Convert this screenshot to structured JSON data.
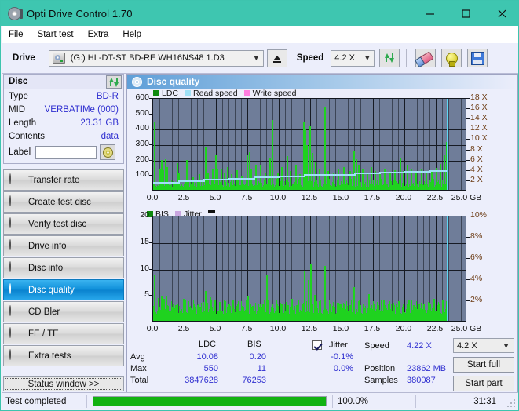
{
  "window": {
    "title": "Opti Drive Control 1.70",
    "icon": "disc-drive-icon",
    "minimize": "—",
    "maximize": "☐",
    "close": "✕"
  },
  "menu": [
    {
      "label": "File"
    },
    {
      "label": "Start test"
    },
    {
      "label": "Extra"
    },
    {
      "label": "Help"
    }
  ],
  "toolbar": {
    "drive_label": "Drive",
    "drive_value": "(G:)  HL-DT-ST BD-RE  WH16NS48 1.D3",
    "eject_title": "eject-icon",
    "speed_label": "Speed",
    "speed_value": "4.2 X",
    "refresh_icon": "refresh-arrows-icon",
    "erase_icon": "eraser-icon",
    "bulb_icon": "bulb-icon",
    "save_icon": "floppy-save-icon"
  },
  "disc": {
    "header": "Disc",
    "refresh_icon": "refresh-arrows-icon",
    "rows": [
      {
        "key": "Type",
        "value": "BD-R"
      },
      {
        "key": "MID",
        "value": "VERBATIMe (000)"
      },
      {
        "key": "Length",
        "value": "23.31 GB"
      },
      {
        "key": "Contents",
        "value": "data"
      }
    ],
    "label_key": "Label",
    "label_value": "",
    "label_placeholder": ""
  },
  "nav": {
    "items": [
      {
        "label": "Transfer rate",
        "selected": false
      },
      {
        "label": "Create test disc",
        "selected": false
      },
      {
        "label": "Verify test disc",
        "selected": false
      },
      {
        "label": "Drive info",
        "selected": false
      },
      {
        "label": "Disc info",
        "selected": false
      },
      {
        "label": "Disc quality",
        "selected": true
      },
      {
        "label": "CD Bler",
        "selected": false
      },
      {
        "label": "FE / TE",
        "selected": false
      },
      {
        "label": "Extra tests",
        "selected": false
      }
    ],
    "status_window": "Status window >>"
  },
  "content": {
    "title": "Disc quality",
    "icon": "disc-quality-icon"
  },
  "stats": {
    "col_ldc": "LDC",
    "col_bis": "BIS",
    "row_avg": "Avg",
    "row_max": "Max",
    "row_total": "Total",
    "ldc_avg": "10.08",
    "ldc_max": "550",
    "ldc_total": "3847628",
    "bis_avg": "0.20",
    "bis_max": "11",
    "bis_total": "76253",
    "jitter_label": "Jitter",
    "jitter_checked": true,
    "jitter_avg": "-0.1%",
    "jitter_max": "0.0%",
    "speed_label": "Speed",
    "speed_value": "4.22 X",
    "position_label": "Position",
    "position_value": "23862 MB",
    "samples_label": "Samples",
    "samples_value": "380087",
    "speed_select": "4.2 X",
    "start_full": "Start full",
    "start_part": "Start part"
  },
  "statusbar": {
    "message": "Test completed",
    "percent": "100.0%",
    "progress": 100,
    "elapsed": "31:31"
  },
  "colors": {
    "title_bar": "#3ec6b0",
    "plot_bg": "#6f7d99",
    "ldc_green": "#1fd21f",
    "read_speed_cyan": "#9fe0f5",
    "write_speed_pink": "#ff7de0",
    "bis_green": "#1fd21f",
    "jitter_lilac": "#c9a6e0",
    "progress_green": "#12b212",
    "value_blue": "#2f2fd0",
    "right_axis_brown": "#6b3a12"
  },
  "chart_data": [
    {
      "type": "line",
      "title": "LDC / Read speed / Write speed",
      "xlabel": "GB",
      "ylabel": "LDC",
      "xlim": [
        0,
        25
      ],
      "ylim": [
        0,
        600
      ],
      "y2lim": [
        0,
        18
      ],
      "y2label": "X",
      "yticks": [
        100,
        200,
        300,
        400,
        500,
        600
      ],
      "y2ticks": [
        2,
        4,
        6,
        8,
        10,
        12,
        14,
        16,
        18
      ],
      "xticks": [
        "0.0",
        "2.5",
        "5.0",
        "7.5",
        "10.0",
        "12.5",
        "15.0",
        "17.5",
        "20.0",
        "22.5",
        "25.0 GB"
      ],
      "grid": true,
      "legend": [
        {
          "name": "LDC",
          "color": "#0f8a0f"
        },
        {
          "name": "Read speed",
          "color": "#9fe0f5"
        },
        {
          "name": "Write speed",
          "color": "#ff7de0"
        }
      ],
      "data_end_gb": 23.4,
      "series": [
        {
          "name": "LDC",
          "color": "#1fd21f",
          "type": "spikes",
          "baseline": 30,
          "peaks": [
            {
              "x": 0.05,
              "y": 455
            },
            {
              "x": 0.5,
              "y": 150
            },
            {
              "x": 0.62,
              "y": 205
            },
            {
              "x": 0.75,
              "y": 135
            },
            {
              "x": 0.95,
              "y": 210
            },
            {
              "x": 1.05,
              "y": 160
            },
            {
              "x": 1.9,
              "y": 185
            },
            {
              "x": 2.0,
              "y": 120
            },
            {
              "x": 2.6,
              "y": 205
            },
            {
              "x": 3.1,
              "y": 90
            },
            {
              "x": 3.6,
              "y": 110
            },
            {
              "x": 4.1,
              "y": 288
            },
            {
              "x": 4.3,
              "y": 120
            },
            {
              "x": 4.7,
              "y": 150
            },
            {
              "x": 4.95,
              "y": 232
            },
            {
              "x": 5.05,
              "y": 140
            },
            {
              "x": 5.4,
              "y": 150
            },
            {
              "x": 5.6,
              "y": 120
            },
            {
              "x": 5.9,
              "y": 160
            },
            {
              "x": 6.2,
              "y": 110
            },
            {
              "x": 6.6,
              "y": 135
            },
            {
              "x": 7.0,
              "y": 95
            },
            {
              "x": 7.45,
              "y": 240
            },
            {
              "x": 7.6,
              "y": 255
            },
            {
              "x": 7.75,
              "y": 150
            },
            {
              "x": 8.1,
              "y": 175
            },
            {
              "x": 8.5,
              "y": 170
            },
            {
              "x": 8.9,
              "y": 120
            },
            {
              "x": 9.25,
              "y": 215
            },
            {
              "x": 9.45,
              "y": 462
            },
            {
              "x": 9.9,
              "y": 120
            },
            {
              "x": 10.2,
              "y": 160
            },
            {
              "x": 10.6,
              "y": 230
            },
            {
              "x": 10.9,
              "y": 130
            },
            {
              "x": 11.3,
              "y": 175
            },
            {
              "x": 11.6,
              "y": 110
            },
            {
              "x": 11.95,
              "y": 452
            },
            {
              "x": 12.05,
              "y": 400
            },
            {
              "x": 12.2,
              "y": 300
            },
            {
              "x": 12.45,
              "y": 420
            },
            {
              "x": 12.6,
              "y": 250
            },
            {
              "x": 12.9,
              "y": 190
            },
            {
              "x": 13.2,
              "y": 150
            },
            {
              "x": 13.6,
              "y": 550
            },
            {
              "x": 13.9,
              "y": 130
            },
            {
              "x": 14.3,
              "y": 120
            },
            {
              "x": 14.7,
              "y": 140
            },
            {
              "x": 15.1,
              "y": 160
            },
            {
              "x": 15.6,
              "y": 130
            },
            {
              "x": 15.95,
              "y": 265
            },
            {
              "x": 16.1,
              "y": 210
            },
            {
              "x": 16.3,
              "y": 170
            },
            {
              "x": 16.6,
              "y": 140
            },
            {
              "x": 17.0,
              "y": 120
            },
            {
              "x": 17.3,
              "y": 160
            },
            {
              "x": 17.6,
              "y": 130
            },
            {
              "x": 18.0,
              "y": 110
            },
            {
              "x": 18.4,
              "y": 145
            },
            {
              "x": 18.8,
              "y": 120
            },
            {
              "x": 19.2,
              "y": 135
            },
            {
              "x": 19.6,
              "y": 215
            },
            {
              "x": 19.9,
              "y": 130
            },
            {
              "x": 20.2,
              "y": 175
            },
            {
              "x": 20.5,
              "y": 150
            },
            {
              "x": 20.9,
              "y": 120
            },
            {
              "x": 21.3,
              "y": 140
            },
            {
              "x": 21.7,
              "y": 115
            },
            {
              "x": 22.1,
              "y": 135
            },
            {
              "x": 22.5,
              "y": 155
            },
            {
              "x": 22.8,
              "y": 180
            },
            {
              "x": 23.1,
              "y": 240
            },
            {
              "x": 23.3,
              "y": 320
            }
          ]
        },
        {
          "name": "Read speed",
          "color": "#9fe0f5",
          "type": "step",
          "points": [
            {
              "x": 0.0,
              "y2": 1.9
            },
            {
              "x": 2.0,
              "y2": 2.1
            },
            {
              "x": 4.0,
              "y2": 2.4
            },
            {
              "x": 6.0,
              "y2": 2.6
            },
            {
              "x": 8.0,
              "y2": 2.9
            },
            {
              "x": 10.0,
              "y2": 3.1
            },
            {
              "x": 12.0,
              "y2": 3.3
            },
            {
              "x": 14.0,
              "y2": 3.4
            },
            {
              "x": 16.0,
              "y2": 3.6
            },
            {
              "x": 18.0,
              "y2": 3.8
            },
            {
              "x": 20.0,
              "y2": 3.9
            },
            {
              "x": 22.0,
              "y2": 4.1
            },
            {
              "x": 23.4,
              "y2": 4.22
            }
          ]
        },
        {
          "name": "end-marker",
          "color": "#5fd8f5",
          "type": "vline",
          "x": 23.4
        }
      ]
    },
    {
      "type": "line",
      "title": "BIS / Jitter",
      "xlabel": "GB",
      "ylabel": "BIS",
      "xlim": [
        0,
        25
      ],
      "ylim": [
        0,
        20
      ],
      "y2lim": [
        0,
        10
      ],
      "y2label": "%",
      "yticks": [
        5,
        10,
        15,
        20
      ],
      "y2ticks": [
        "2%",
        "4%",
        "6%",
        "8%",
        "10%"
      ],
      "xticks": [
        "0.0",
        "2.5",
        "5.0",
        "7.5",
        "10.0",
        "12.5",
        "15.0",
        "17.5",
        "20.0",
        "22.5",
        "25.0 GB"
      ],
      "grid": true,
      "legend": [
        {
          "name": "BIS",
          "color": "#0f8a0f"
        },
        {
          "name": "Jitter",
          "color": "#c9a6e0"
        }
      ],
      "data_end_gb": 23.4,
      "series": [
        {
          "name": "BIS",
          "color": "#1fd21f",
          "type": "spikes",
          "baseline": 1.6,
          "peaks": [
            {
              "x": 0.05,
              "y": 9.0
            },
            {
              "x": 0.4,
              "y": 4.6
            },
            {
              "x": 0.6,
              "y": 5.0
            },
            {
              "x": 0.8,
              "y": 4.4
            },
            {
              "x": 1.0,
              "y": 5.0
            },
            {
              "x": 1.5,
              "y": 3.0
            },
            {
              "x": 1.9,
              "y": 3.3
            },
            {
              "x": 2.4,
              "y": 4.5
            },
            {
              "x": 2.8,
              "y": 3.0
            },
            {
              "x": 3.2,
              "y": 3.4
            },
            {
              "x": 3.7,
              "y": 3.0
            },
            {
              "x": 4.1,
              "y": 6.0
            },
            {
              "x": 4.5,
              "y": 4.8
            },
            {
              "x": 4.9,
              "y": 4.2
            },
            {
              "x": 5.3,
              "y": 3.9
            },
            {
              "x": 5.7,
              "y": 4.0
            },
            {
              "x": 6.0,
              "y": 3.4
            },
            {
              "x": 6.3,
              "y": 4.3
            },
            {
              "x": 6.7,
              "y": 3.4
            },
            {
              "x": 7.1,
              "y": 3.0
            },
            {
              "x": 7.5,
              "y": 5.0
            },
            {
              "x": 7.9,
              "y": 3.1
            },
            {
              "x": 8.3,
              "y": 3.4
            },
            {
              "x": 8.7,
              "y": 3.6
            },
            {
              "x": 9.0,
              "y": 9.0
            },
            {
              "x": 9.4,
              "y": 3.0
            },
            {
              "x": 9.8,
              "y": 3.4
            },
            {
              "x": 10.2,
              "y": 3.5
            },
            {
              "x": 10.6,
              "y": 3.2
            },
            {
              "x": 11.0,
              "y": 4.4
            },
            {
              "x": 11.4,
              "y": 3.2
            },
            {
              "x": 11.8,
              "y": 3.4
            },
            {
              "x": 12.0,
              "y": 9.8
            },
            {
              "x": 12.3,
              "y": 8.0
            },
            {
              "x": 12.5,
              "y": 11.0
            },
            {
              "x": 12.8,
              "y": 5.2
            },
            {
              "x": 13.2,
              "y": 4.0
            },
            {
              "x": 13.6,
              "y": 10.6
            },
            {
              "x": 14.0,
              "y": 3.6
            },
            {
              "x": 14.4,
              "y": 3.0
            },
            {
              "x": 14.8,
              "y": 3.6
            },
            {
              "x": 15.2,
              "y": 3.4
            },
            {
              "x": 15.6,
              "y": 3.2
            },
            {
              "x": 15.95,
              "y": 6.6
            },
            {
              "x": 16.3,
              "y": 4.0
            },
            {
              "x": 16.7,
              "y": 3.4
            },
            {
              "x": 17.1,
              "y": 5.4
            },
            {
              "x": 17.5,
              "y": 3.6
            },
            {
              "x": 17.9,
              "y": 3.2
            },
            {
              "x": 18.3,
              "y": 4.2
            },
            {
              "x": 18.7,
              "y": 3.4
            },
            {
              "x": 19.1,
              "y": 3.2
            },
            {
              "x": 19.5,
              "y": 4.0
            },
            {
              "x": 19.9,
              "y": 3.4
            },
            {
              "x": 20.3,
              "y": 4.2
            },
            {
              "x": 20.7,
              "y": 3.2
            },
            {
              "x": 21.1,
              "y": 3.6
            },
            {
              "x": 21.5,
              "y": 3.4
            },
            {
              "x": 21.9,
              "y": 3.8
            },
            {
              "x": 22.3,
              "y": 4.4
            },
            {
              "x": 22.7,
              "y": 3.6
            },
            {
              "x": 23.0,
              "y": 4.2
            },
            {
              "x": 23.3,
              "y": 4.0
            }
          ]
        },
        {
          "name": "end-marker",
          "color": "#5fd8f5",
          "type": "vline",
          "x": 23.4
        }
      ]
    }
  ]
}
